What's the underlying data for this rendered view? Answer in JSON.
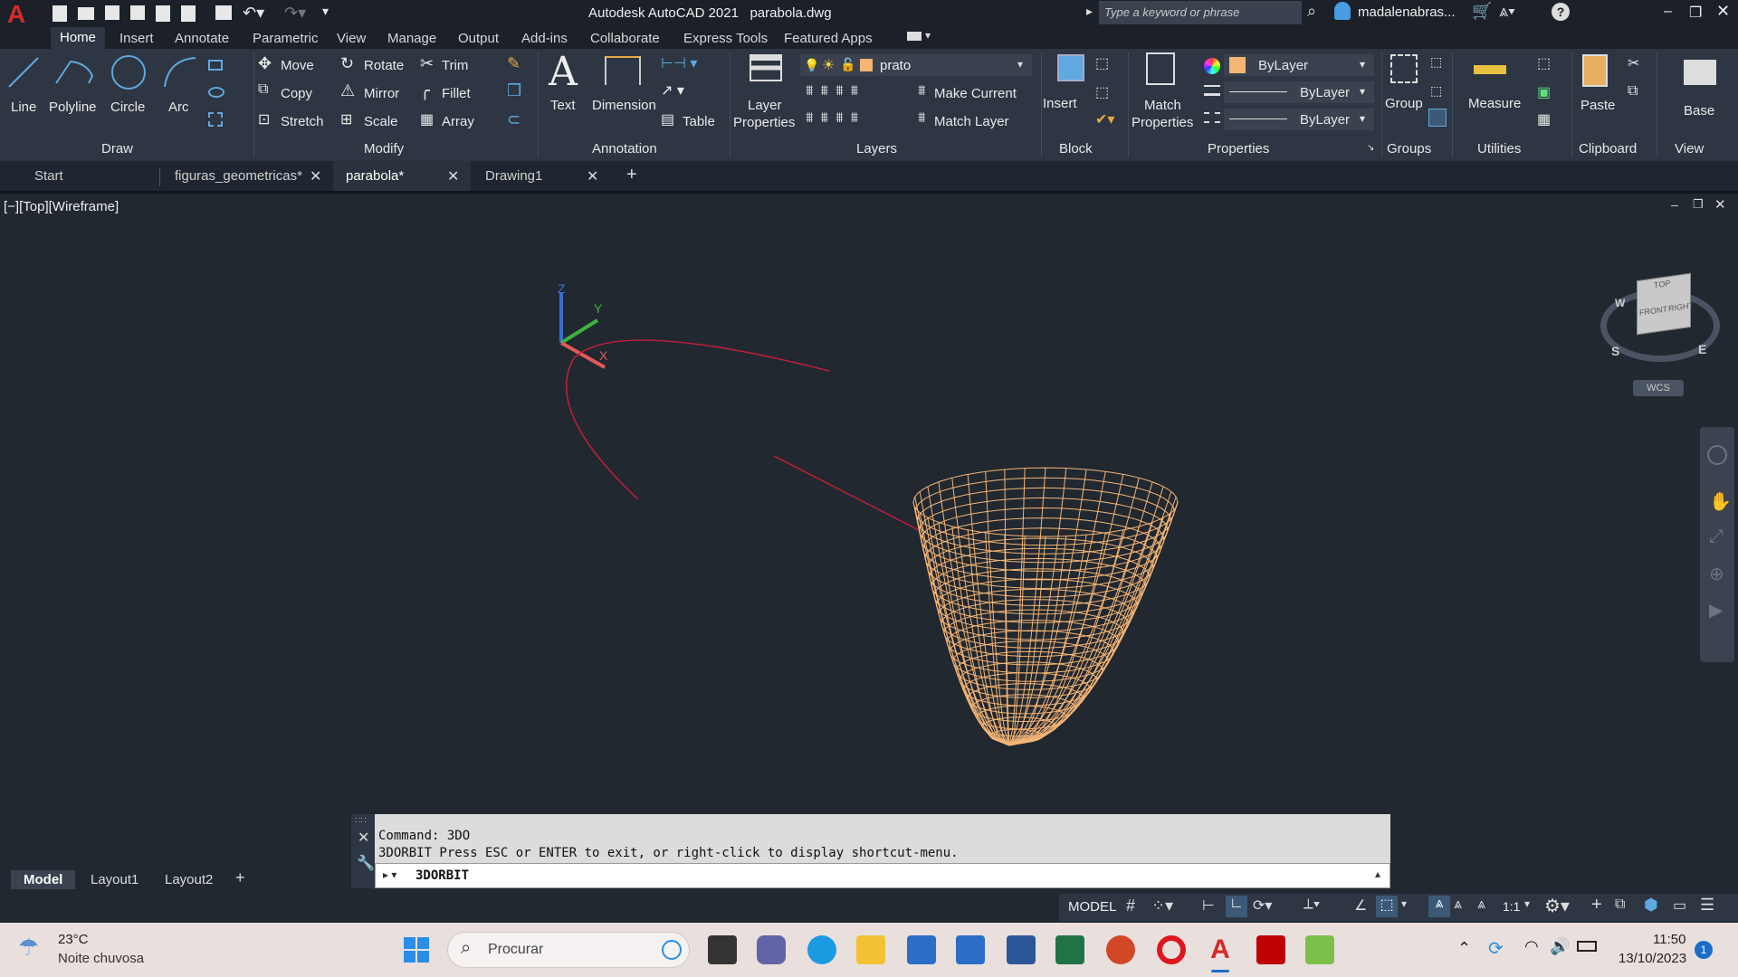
{
  "titlebar": {
    "app_title": "Autodesk AutoCAD 2021",
    "file_name": "parabola.dwg",
    "search_placeholder": "Type a keyword or phrase",
    "user": "madalenabras..."
  },
  "ribbon_tabs": [
    "Home",
    "Insert",
    "Annotate",
    "Parametric",
    "View",
    "Manage",
    "Output",
    "Add-ins",
    "Collaborate",
    "Express Tools",
    "Featured Apps"
  ],
  "draw": {
    "line": "Line",
    "polyline": "Polyline",
    "circle": "Circle",
    "arc": "Arc",
    "title": "Draw"
  },
  "modify": {
    "move": "Move",
    "rotate": "Rotate",
    "trim": "Trim",
    "copy": "Copy",
    "mirror": "Mirror",
    "fillet": "Fillet",
    "stretch": "Stretch",
    "scale": "Scale",
    "array": "Array",
    "title": "Modify"
  },
  "annotation": {
    "text": "Text",
    "dimension": "Dimension",
    "table": "Table",
    "title": "Annotation"
  },
  "layers": {
    "layer_properties_1": "Layer",
    "layer_properties_2": "Properties",
    "current_layer": "prato",
    "make_current": "Make Current",
    "match_layer": "Match Layer",
    "title": "Layers"
  },
  "block": {
    "insert": "Insert",
    "title": "Block"
  },
  "properties": {
    "match_1": "Match",
    "match_2": "Properties",
    "color": "ByLayer",
    "linetype": "ByLayer",
    "lineweight": "ByLayer",
    "title": "Properties"
  },
  "groups": {
    "group": "Group",
    "title": "Groups"
  },
  "utilities": {
    "measure": "Measure",
    "title": "Utilities"
  },
  "clipboard": {
    "paste": "Paste",
    "title": "Clipboard"
  },
  "view_panel": {
    "base": "Base",
    "title": "View"
  },
  "doc_tabs": [
    "Start",
    "figuras_geometricas*",
    "parabola*",
    "Drawing1"
  ],
  "viewport": {
    "label": "[−][Top][Wireframe]",
    "wcs": "WCS",
    "ucs_x": "X",
    "ucs_y": "Y",
    "ucs_z": "Z"
  },
  "viewcube": {
    "top": "TOP",
    "front": "FRONT",
    "right": "RIGHT",
    "w": "W",
    "s": "S",
    "e": "E"
  },
  "command": {
    "line1": "Command: 3DO",
    "line2": "3DORBIT Press ESC or ENTER to exit, or right-click to display shortcut-menu.",
    "input": "3DORBIT"
  },
  "layout_tabs": [
    "Model",
    "Layout1",
    "Layout2"
  ],
  "status": {
    "model": "MODEL",
    "scale": "1:1"
  },
  "taskbar": {
    "temp": "23°C",
    "weather": "Noite chuvosa",
    "search": "Procurar",
    "time": "11:50",
    "date": "13/10/2023",
    "notif": "1"
  },
  "colors": {
    "accent": "#0a6ebd",
    "curve": "#c41e3a",
    "mesh": "#f5b576",
    "ribbon": "#2d3642"
  }
}
